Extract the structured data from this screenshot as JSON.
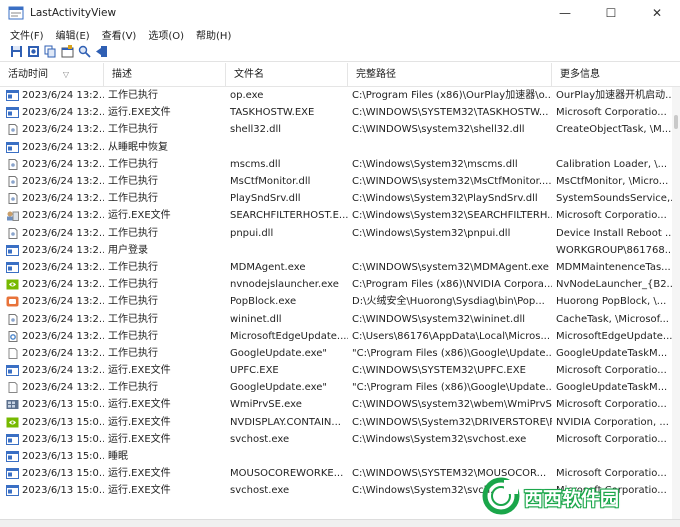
{
  "window": {
    "title": "LastActivityView",
    "minimize_glyph": "—",
    "maximize_glyph": "☐",
    "close_glyph": "✕"
  },
  "menu": [
    "文件(F)",
    "编辑(E)",
    "查看(V)",
    "选项(O)",
    "帮助(H)"
  ],
  "toolbar": [
    "save-icon",
    "html-report-icon",
    "copy-icon",
    "properties-icon",
    "search-icon",
    "exit-icon"
  ],
  "columns": [
    "活动时间",
    "描述",
    "文件名",
    "完整路径",
    "更多信息"
  ],
  "sort_indicator": "▽",
  "rows": [
    {
      "icon": "window",
      "time": "2023/6/24 13:2...",
      "desc": "工作已执行",
      "file": "op.exe",
      "path": "C:\\Program Files (x86)\\OurPlay加速器\\o...",
      "info": "OurPlay加速器开机启动..."
    },
    {
      "icon": "window",
      "time": "2023/6/24 13:2...",
      "desc": "运行.EXE文件",
      "file": "TASKHOSTW.EXE",
      "path": "C:\\WINDOWS\\SYSTEM32\\TASKHOSTW...",
      "info": "Microsoft Corporatio..."
    },
    {
      "icon": "doc",
      "time": "2023/6/24 13:2...",
      "desc": "工作已执行",
      "file": "shell32.dll",
      "path": "C:\\WINDOWS\\system32\\shell32.dll",
      "info": "CreateObjectTask, \\M..."
    },
    {
      "icon": "window",
      "time": "2023/6/24 13:2...",
      "desc": "从睡眠中恢复",
      "file": "",
      "path": "",
      "info": ""
    },
    {
      "icon": "doc",
      "time": "2023/6/24 13:2...",
      "desc": "工作已执行",
      "file": "mscms.dll",
      "path": "C:\\Windows\\System32\\mscms.dll",
      "info": "Calibration Loader, \\..."
    },
    {
      "icon": "doc",
      "time": "2023/6/24 13:2...",
      "desc": "工作已执行",
      "file": "MsCtfMonitor.dll",
      "path": "C:\\WINDOWS\\system32\\MsCtfMonitor....",
      "info": "MsCtfMonitor, \\Micro..."
    },
    {
      "icon": "doc",
      "time": "2023/6/24 13:2...",
      "desc": "工作已执行",
      "file": "PlaySndSrv.dll",
      "path": "C:\\Windows\\System32\\PlaySndSrv.dll",
      "info": "SystemSoundsService,..."
    },
    {
      "icon": "search",
      "time": "2023/6/24 13:2...",
      "desc": "运行.EXE文件",
      "file": "SEARCHFILTERHOST.E...",
      "path": "C:\\Windows\\System32\\SEARCHFILTERH...",
      "info": "Microsoft Corporatio..."
    },
    {
      "icon": "doc",
      "time": "2023/6/24 13:2...",
      "desc": "工作已执行",
      "file": "pnpui.dll",
      "path": "C:\\Windows\\System32\\pnpui.dll",
      "info": "Device Install Reboot ..."
    },
    {
      "icon": "window",
      "time": "2023/6/24 13:2...",
      "desc": "用户登录",
      "file": "",
      "path": "",
      "info": "WORKGROUP\\861768..."
    },
    {
      "icon": "window",
      "time": "2023/6/24 13:2...",
      "desc": "工作已执行",
      "file": "MDMAgent.exe",
      "path": "C:\\WINDOWS\\system32\\MDMAgent.exe",
      "info": "MDMMaintenenceTas..."
    },
    {
      "icon": "nvidia",
      "time": "2023/6/24 13:2...",
      "desc": "工作已执行",
      "file": "nvnodejslauncher.exe",
      "path": "C:\\Program Files (x86)\\NVIDIA Corpora...",
      "info": "NvNodeLauncher_{B2..."
    },
    {
      "icon": "orange",
      "time": "2023/6/24 13:2...",
      "desc": "工作已执行",
      "file": "PopBlock.exe",
      "path": "D:\\火绒安全\\Huorong\\Sysdiag\\bin\\Pop...",
      "info": "Huorong PopBlock, \\..."
    },
    {
      "icon": "doc",
      "time": "2023/6/24 13:2...",
      "desc": "工作已执行",
      "file": "wininet.dll",
      "path": "C:\\WINDOWS\\system32\\wininet.dll",
      "info": "CacheTask, \\Microsof..."
    },
    {
      "icon": "gear",
      "time": "2023/6/24 13:2...",
      "desc": "工作已执行",
      "file": "MicrosoftEdgeUpdate....",
      "path": "C:\\Users\\86176\\AppData\\Local\\Micros...",
      "info": "MicrosoftEdgeUpdate..."
    },
    {
      "icon": "blank",
      "time": "2023/6/24 13:2...",
      "desc": "工作已执行",
      "file": "GoogleUpdate.exe\"",
      "path": "\"C:\\Program Files (x86)\\Google\\Update...",
      "info": "GoogleUpdateTaskM..."
    },
    {
      "icon": "window",
      "time": "2023/6/24 13:2...",
      "desc": "运行.EXE文件",
      "file": "UPFC.EXE",
      "path": "C:\\WINDOWS\\SYSTEM32\\UPFC.EXE",
      "info": "Microsoft Corporatio..."
    },
    {
      "icon": "blank",
      "time": "2023/6/24 13:2...",
      "desc": "工作已执行",
      "file": "GoogleUpdate.exe\"",
      "path": "\"C:\\Program Files (x86)\\Google\\Update...",
      "info": "GoogleUpdateTaskM..."
    },
    {
      "icon": "grid",
      "time": "2023/6/13 15:0...",
      "desc": "运行.EXE文件",
      "file": "WmiPrvSE.exe",
      "path": "C:\\WINDOWS\\system32\\wbem\\WmiPrvSE....",
      "info": "Microsoft Corporatio..."
    },
    {
      "icon": "nvidia",
      "time": "2023/6/13 15:0...",
      "desc": "运行.EXE文件",
      "file": "NVDISPLAY.CONTAIN...",
      "path": "C:\\WINDOWS\\System32\\DRIVERSTORE\\F...",
      "info": "NVIDIA Corporation, ..."
    },
    {
      "icon": "window",
      "time": "2023/6/13 15:0...",
      "desc": "运行.EXE文件",
      "file": "svchost.exe",
      "path": "C:\\Windows\\System32\\svchost.exe",
      "info": "Microsoft Corporatio..."
    },
    {
      "icon": "window",
      "time": "2023/6/13 15:0...",
      "desc": "睡眠",
      "file": "",
      "path": "",
      "info": ""
    },
    {
      "icon": "window",
      "time": "2023/6/13 15:0...",
      "desc": "运行.EXE文件",
      "file": "MOUSOCOREWORKE...",
      "path": "C:\\WINDOWS\\SYSTEM32\\MOUSOCOR...",
      "info": "Microsoft Corporatio..."
    },
    {
      "icon": "window",
      "time": "2023/6/13 15:0...",
      "desc": "运行.EXE文件",
      "file": "svchost.exe",
      "path": "C:\\Windows\\System32\\svch...",
      "info": "Microsoft Corporatio..."
    }
  ],
  "watermark": {
    "text": "西西软件园"
  },
  "colors": {
    "window_icon": "#3a6fc4",
    "nvidia": "#76b900",
    "orange": "#e8733a",
    "watermark_green": "#1aa64a"
  }
}
